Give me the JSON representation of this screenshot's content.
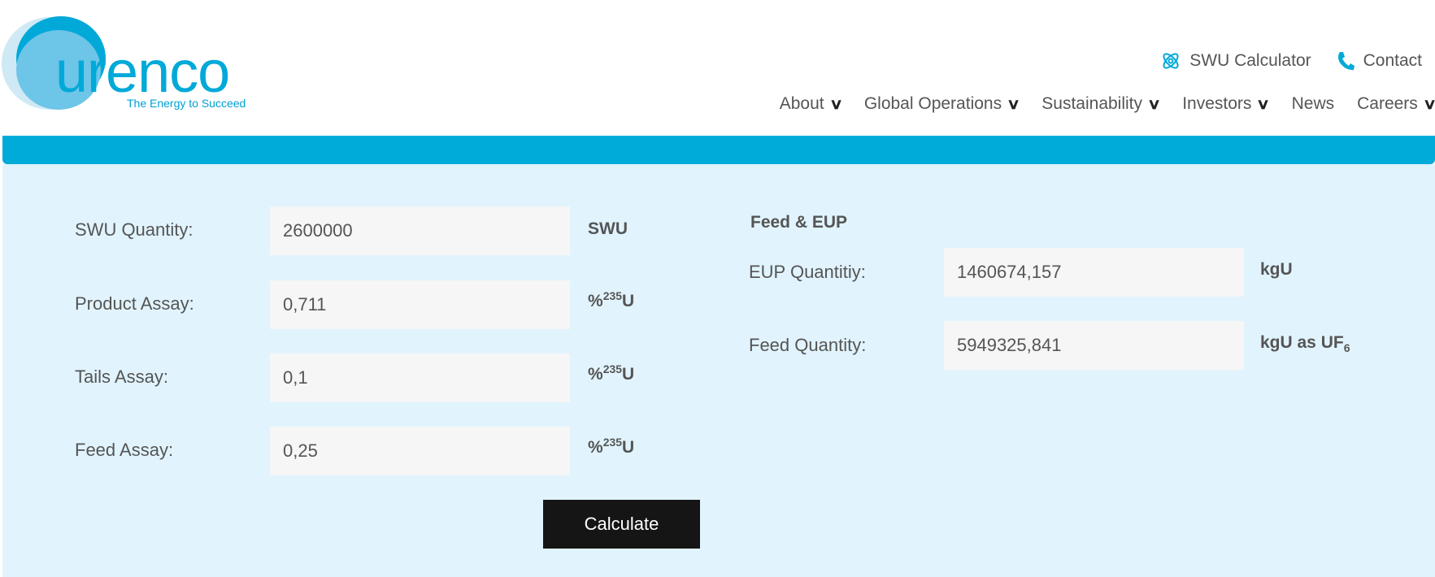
{
  "brand": {
    "name": "urenco",
    "tagline": "The Energy to Succeed",
    "color": "#00a9d8"
  },
  "top_links": [
    {
      "label": "SWU Calculator",
      "icon": "atom-icon"
    },
    {
      "label": "Contact",
      "icon": "phone-icon"
    }
  ],
  "nav": [
    {
      "label": "About",
      "dropdown": true
    },
    {
      "label": "Global Operations",
      "dropdown": true
    },
    {
      "label": "Sustainability",
      "dropdown": true
    },
    {
      "label": "Investors",
      "dropdown": true
    },
    {
      "label": "News",
      "dropdown": false
    },
    {
      "label": "Careers",
      "dropdown": true
    }
  ],
  "form": {
    "swu": {
      "label": "SWU Quantity:",
      "value": "2600000",
      "unit": "SWU"
    },
    "product": {
      "label": "Product Assay:",
      "value": "0,711",
      "unit_pre": "%",
      "unit_sup": "235",
      "unit_post": "U"
    },
    "tails": {
      "label": "Tails Assay:",
      "value": "0,1",
      "unit_pre": "%",
      "unit_sup": "235",
      "unit_post": "U"
    },
    "feed": {
      "label": "Feed Assay:",
      "value": "0,25",
      "unit_pre": "%",
      "unit_sup": "235",
      "unit_post": "U"
    },
    "calculate": "Calculate"
  },
  "results": {
    "heading": "Feed & EUP",
    "eup": {
      "label": "EUP Quantitiy:",
      "value": "1460674,157",
      "unit": "kgU"
    },
    "feed": {
      "label": "Feed Quantity:",
      "value": "5949325,841",
      "unit": "kgU as UF",
      "unit_sub": "6"
    }
  }
}
